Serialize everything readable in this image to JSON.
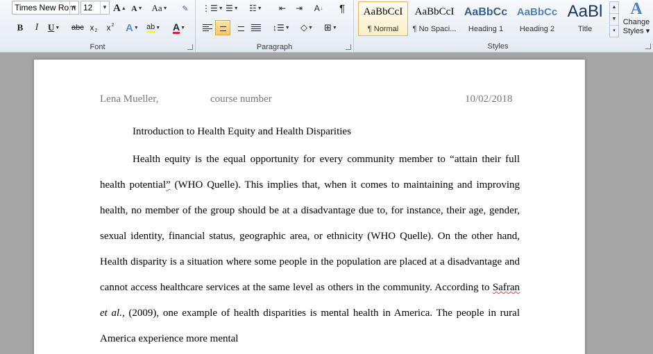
{
  "font_group": {
    "font_name": "Times New Rom",
    "font_size": "12",
    "grow_label": "A",
    "shrink_label": "A",
    "case_label": "Aa",
    "bold": "B",
    "italic": "I",
    "underline": "U",
    "strikethrough": "abc",
    "subscript": "x",
    "superscript": "x",
    "text_effects": "A",
    "highlight": "ab",
    "font_color": "A",
    "label": "Font"
  },
  "paragraph_group": {
    "sort_label": "A",
    "pilcrow": "¶",
    "label": "Paragraph"
  },
  "styles_group": {
    "items": [
      {
        "sample": "AaBbCcI",
        "name": "¶ Normal"
      },
      {
        "sample": "AaBbCcI",
        "name": "¶ No Spaci..."
      },
      {
        "sample": "AaBbCc",
        "name": "Heading 1"
      },
      {
        "sample": "AaBbCc",
        "name": "Heading 2"
      },
      {
        "sample": "AaBl",
        "name": "Title"
      }
    ],
    "change_styles": [
      "Change",
      "Styles ▾"
    ],
    "label": "Styles"
  },
  "colors": {
    "accent": "#2b579a",
    "highlight": "#ffff00",
    "font_color": "#e02020",
    "heading": "#365f91"
  },
  "document": {
    "header_left": "Lena Mueller,",
    "header_middle": "course number",
    "header_right": "10/02/2018",
    "title": "Introduction to Health Equity and Health Disparities",
    "p1": "Health equity is the equal opportunity for every community member to “attain their full health potential",
    "p1_quote": "”",
    "p2": " (WHO Quelle). This implies that, when it comes to maintaining and improving health, no member of the group should be at a disadvantage due to, for instance, their age, gender, sexual identity, financial status, geographic area, or ethnicity (WHO Quelle). On the other hand, Health disparity is a situation where some people in the population are placed at a disadvantage and cannot access healthcare services at the same level as others in the community. According to ",
    "p3_author": "Safran",
    "p3_etal": "et al.,",
    "p4": " (2009), one example of health disparities is mental health in America. The people in rural America experience more mental"
  }
}
